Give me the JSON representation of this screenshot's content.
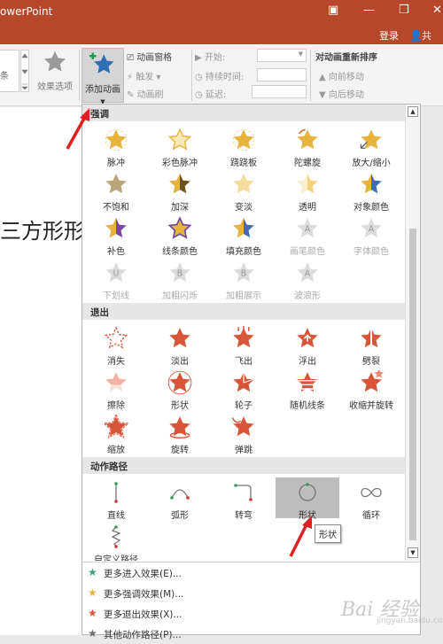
{
  "window": {
    "app_title": "owerPoint",
    "login_label": "登录",
    "share_label": "共享",
    "buttons": [
      "restore-ribbon",
      "minimize",
      "maximize",
      "close"
    ]
  },
  "ribbon": {
    "left_fragment": "条",
    "effect_options_label": "效果选项",
    "add_animation_label": "添加动画",
    "animation_pane_label": "动画窗格",
    "trigger_label": "触发",
    "animation_painter_label": "动画刷",
    "start_label": "开始:",
    "duration_label": "持续时间:",
    "delay_label": "延迟:",
    "reorder_title": "对动画重新排序",
    "move_earlier_label": "向前移动",
    "move_later_label": "向后移动"
  },
  "slide": {
    "text": "三方形形"
  },
  "gallery": {
    "sections": [
      {
        "title": "强调",
        "items": [
          {
            "label": "脉冲",
            "disabled": false,
            "icon": "pulse-star-icon"
          },
          {
            "label": "彩色脉冲",
            "disabled": false,
            "icon": "color-pulse-star-icon"
          },
          {
            "label": "跷跷板",
            "disabled": false,
            "icon": "teeter-star-icon"
          },
          {
            "label": "陀螺旋",
            "disabled": false,
            "icon": "spin-star-icon"
          },
          {
            "label": "放大/缩小",
            "disabled": false,
            "icon": "grow-shrink-star-icon"
          },
          {
            "label": "不饱和",
            "disabled": false,
            "icon": "desaturate-star-icon"
          },
          {
            "label": "加深",
            "disabled": false,
            "icon": "darken-star-icon"
          },
          {
            "label": "变淡",
            "disabled": false,
            "icon": "lighten-star-icon"
          },
          {
            "label": "透明",
            "disabled": false,
            "icon": "transparency-star-icon"
          },
          {
            "label": "对象颜色",
            "disabled": false,
            "icon": "object-color-star-icon"
          },
          {
            "label": "补色",
            "disabled": false,
            "icon": "complementary-color-star-icon"
          },
          {
            "label": "线条颜色",
            "disabled": false,
            "icon": "line-color-star-icon"
          },
          {
            "label": "填充颜色",
            "disabled": false,
            "icon": "fill-color-star-icon"
          },
          {
            "label": "画笔颜色",
            "disabled": true,
            "icon": "brush-color-icon"
          },
          {
            "label": "字体颜色",
            "disabled": true,
            "icon": "font-color-icon"
          },
          {
            "label": "下划线",
            "disabled": true,
            "icon": "underline-icon"
          },
          {
            "label": "加粗闪烁",
            "disabled": true,
            "icon": "bold-flash-icon"
          },
          {
            "label": "加粗展示",
            "disabled": true,
            "icon": "bold-reveal-icon"
          },
          {
            "label": "波浪形",
            "disabled": true,
            "icon": "wave-icon"
          }
        ]
      },
      {
        "title": "退出",
        "items": [
          {
            "label": "消失",
            "disabled": false,
            "icon": "disappear-star-icon"
          },
          {
            "label": "淡出",
            "disabled": false,
            "icon": "fade-star-icon"
          },
          {
            "label": "飞出",
            "disabled": false,
            "icon": "fly-out-star-icon"
          },
          {
            "label": "浮出",
            "disabled": false,
            "icon": "float-out-star-icon"
          },
          {
            "label": "劈裂",
            "disabled": false,
            "icon": "split-star-icon"
          },
          {
            "label": "擦除",
            "disabled": false,
            "icon": "wipe-star-icon"
          },
          {
            "label": "形状",
            "disabled": false,
            "icon": "shape-star-icon"
          },
          {
            "label": "轮子",
            "disabled": false,
            "icon": "wheel-star-icon"
          },
          {
            "label": "随机线条",
            "disabled": false,
            "icon": "random-bars-star-icon"
          },
          {
            "label": "收缩并旋转",
            "disabled": false,
            "icon": "shrink-turn-star-icon"
          },
          {
            "label": "缩放",
            "disabled": false,
            "icon": "zoom-star-icon"
          },
          {
            "label": "旋转",
            "disabled": false,
            "icon": "swivel-star-icon"
          },
          {
            "label": "弹跳",
            "disabled": false,
            "icon": "bounce-star-icon"
          }
        ]
      },
      {
        "title": "动作路径",
        "items": [
          {
            "label": "直线",
            "disabled": false,
            "icon": "line-path-icon"
          },
          {
            "label": "弧形",
            "disabled": false,
            "icon": "arc-path-icon"
          },
          {
            "label": "转弯",
            "disabled": false,
            "icon": "turn-path-icon"
          },
          {
            "label": "形状",
            "disabled": false,
            "icon": "shape-path-icon",
            "selected": true
          },
          {
            "label": "循环",
            "disabled": false,
            "icon": "loop-path-icon"
          },
          {
            "label": "自定义路径",
            "disabled": false,
            "icon": "custom-path-icon"
          }
        ]
      }
    ],
    "tooltip": "形状"
  },
  "menu": [
    {
      "label": "更多进入效果(E)...",
      "color": "#3fa07a"
    },
    {
      "label": "更多强调效果(M)...",
      "color": "#e8b33a"
    },
    {
      "label": "更多退出效果(X)...",
      "color": "#d9553a"
    },
    {
      "label": "其他动作路径(P)...",
      "color": "#6b6b6b"
    }
  ],
  "watermark": {
    "text": "Bai 经验",
    "sub": "jingyan.baidu.com"
  },
  "colors": {
    "title_bar": "#b7472a",
    "emphasis_star": "#e8b33a",
    "exit_star": "#d9553a",
    "entrance_star": "#3fa07a",
    "annotation_arrow": "#e02020"
  }
}
